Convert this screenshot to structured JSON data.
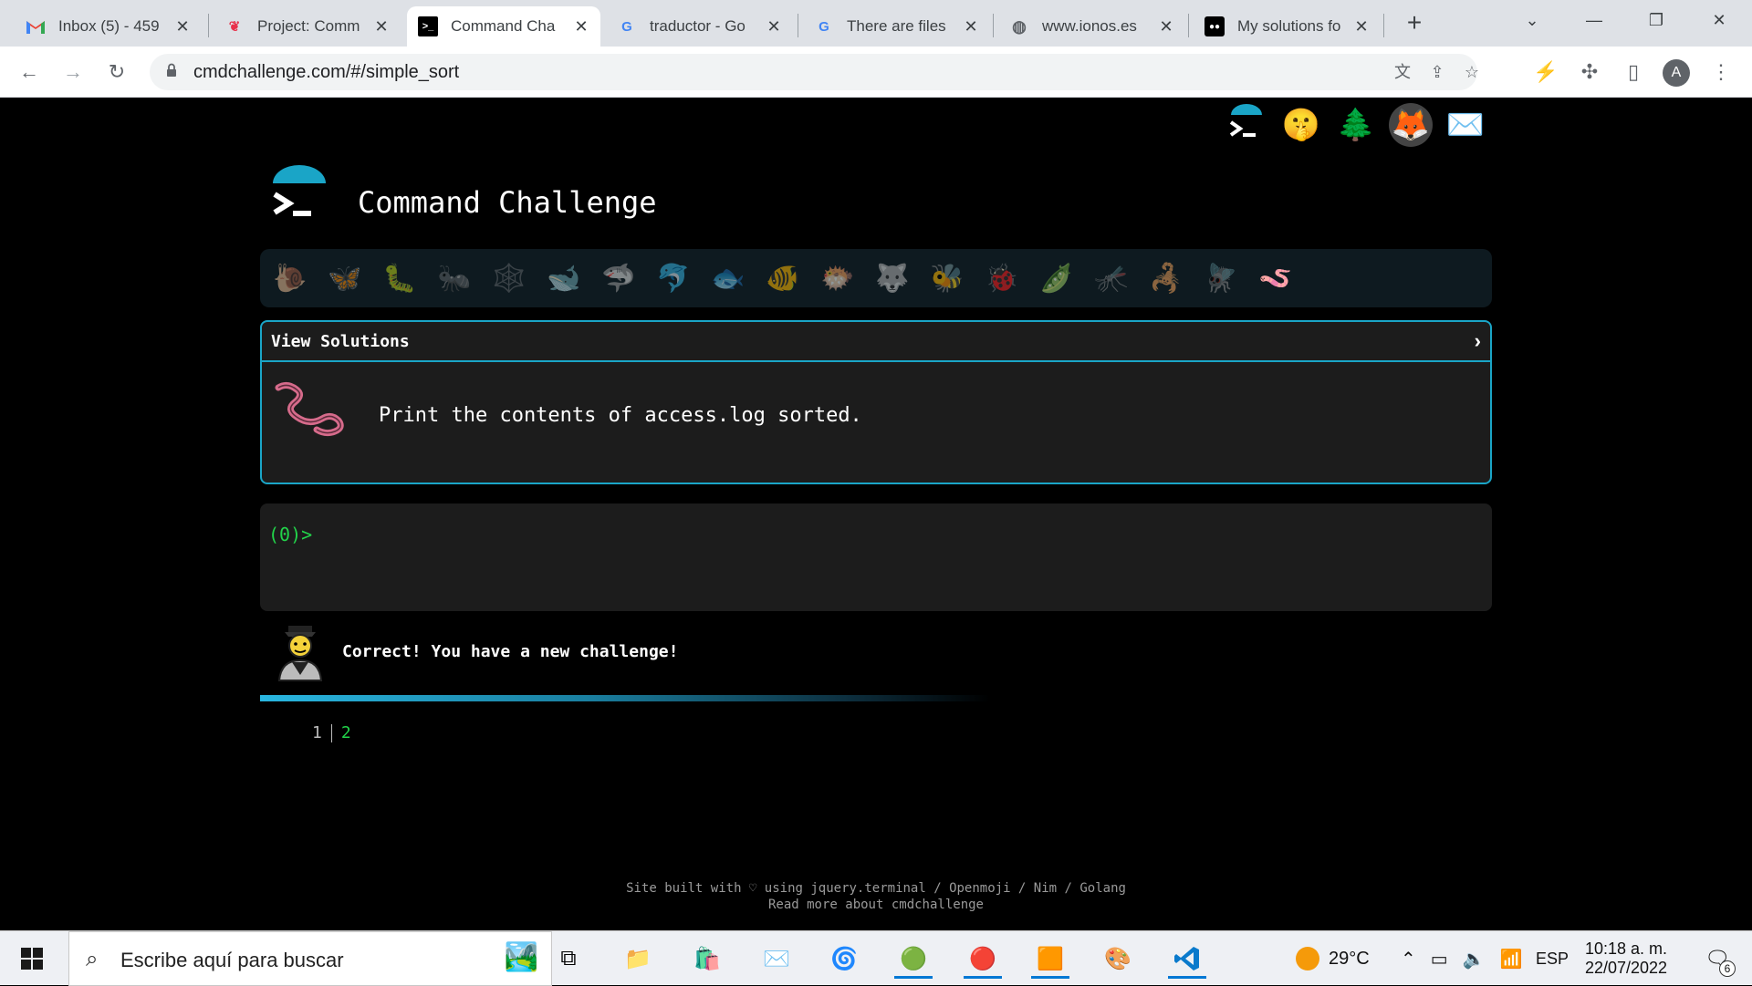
{
  "tabs": [
    {
      "title": "Inbox (5) - 459",
      "icon": "gmail-icon"
    },
    {
      "title": "Project: Comm",
      "icon": "project-icon"
    },
    {
      "title": "Command Cha",
      "icon": "terminal-icon",
      "active": true
    },
    {
      "title": "traductor - Go",
      "icon": "google-icon"
    },
    {
      "title": "There are files",
      "icon": "google-icon"
    },
    {
      "title": "www.ionos.es",
      "icon": "globe-icon"
    },
    {
      "title": "My solutions fo",
      "icon": "medium-icon"
    }
  ],
  "address": {
    "url": "cmdchallenge.com/#/simple_sort"
  },
  "profile": {
    "initial": "A"
  },
  "site": {
    "title": "Command Challenge"
  },
  "panel": {
    "label": "View Solutions",
    "task": "Print the contents of access.log sorted."
  },
  "terminal": {
    "prompt": "(0)>"
  },
  "feedback": {
    "message": "Correct! You have a new challenge!"
  },
  "pager": {
    "page1": "1",
    "page2": "2"
  },
  "footer": {
    "line1": "Site built with ♡ using jquery.terminal / Openmoji / Nim / Golang",
    "line2": "Read more about cmdchallenge"
  },
  "taskbar": {
    "search_placeholder": "Escribe aquí para buscar",
    "temperature": "29°C",
    "language": "ESP",
    "time": "10:18 a. m.",
    "date": "22/07/2022",
    "notifications": "6"
  },
  "colors": {
    "accent": "#1aa5c7",
    "prompt": "#22d34a",
    "panel_bg": "#1c1c1c"
  }
}
